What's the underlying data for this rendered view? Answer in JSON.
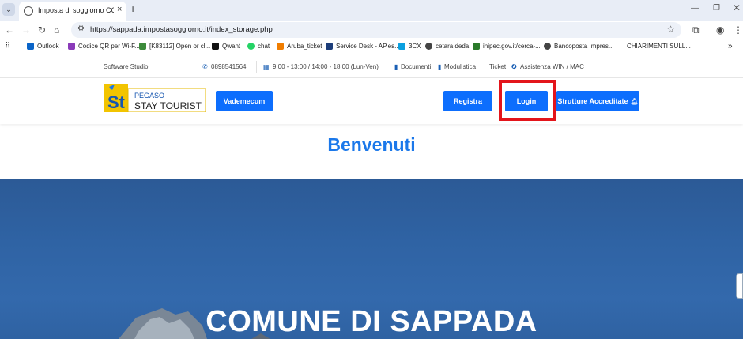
{
  "browser": {
    "tab_title": "Imposta di soggiorno COMUNE",
    "url": "https://sappada.impostasoggiorno.it/index_storage.php",
    "bookmarks": [
      "Outlook",
      "Codice QR per Wi-F...",
      "[K83112] Open or cl...",
      "Qwant",
      "chat",
      "Aruba_ticket",
      "Service Desk - AP.es...",
      "3CX",
      "cetara.deda",
      "inipec.gov.it/cerca-...",
      "Bancoposta Impres...",
      "CHIARIMENTI SULL..."
    ]
  },
  "topbar": {
    "company": "Software Studio",
    "phone": "0898541564",
    "hours": "9:00 - 13:00 / 14:00 - 18:00 (Lun-Ven)",
    "documenti": "Documenti",
    "modulistica": "Modulistica",
    "ticket": "Ticket",
    "assistenza": "Assistenza WIN / MAC"
  },
  "header": {
    "logo_pegaso": "PEGASO",
    "logo_stay": "STAY TOURIST",
    "logo_st": "St",
    "vademecum": "Vademecum",
    "registra": "Registra",
    "login": "Login",
    "strutture": "Strutture Accreditate"
  },
  "welcome": "Benvenuti",
  "hero": {
    "title": "COMUNE DI SAPPADA"
  },
  "colors": {
    "accent": "#0d6efd",
    "welcome": "#1b78ea",
    "highlight": "#e3151b"
  }
}
